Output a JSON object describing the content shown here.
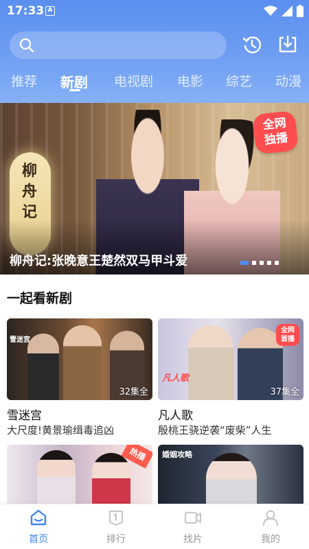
{
  "status_bar": {
    "time": "17:33",
    "notification_glyph": "A",
    "icons": [
      "wifi-icon",
      "signal-icon",
      "battery-icon"
    ]
  },
  "header": {
    "search_placeholder": "",
    "actions": [
      "history-icon",
      "download-icon"
    ],
    "tabs": [
      {
        "label": "推荐",
        "active": false
      },
      {
        "label": "新剧",
        "active": true
      },
      {
        "label": "电视剧",
        "active": false
      },
      {
        "label": "电影",
        "active": false
      },
      {
        "label": "综艺",
        "active": false
      },
      {
        "label": "动漫",
        "active": false
      }
    ]
  },
  "banner": {
    "title": "柳舟记:张晚意王楚然双马甲斗爱",
    "poster_text": "柳舟记",
    "badge": "全网独播",
    "dot_count": 5,
    "active_dot": 0
  },
  "section": {
    "title": "一起看新剧",
    "cards": [
      {
        "title": "雪迷宫",
        "desc": "大尺度!黄景瑜缉毒追凶",
        "count": "32集全",
        "poster_logo": "雪迷宫"
      },
      {
        "title": "凡人歌",
        "desc": "殷桃王骁逆袭“废柴”人生",
        "count": "37集全",
        "poster_logo": "凡人歌",
        "badge": "全网首播"
      },
      {
        "title": "",
        "desc": "",
        "count": "",
        "badge": "热播"
      },
      {
        "title": "",
        "desc": "",
        "count": "",
        "poster_logo": "婚姻攻略"
      }
    ]
  },
  "bottom_nav": [
    {
      "label": "首页",
      "icon": "home-icon",
      "active": true
    },
    {
      "label": "排行",
      "icon": "ranking-icon",
      "active": false
    },
    {
      "label": "找片",
      "icon": "video-camera-icon",
      "active": false
    },
    {
      "label": "我的",
      "icon": "profile-icon",
      "active": false
    }
  ],
  "colors": {
    "header_gradient_top": "#5b8ff0",
    "accent": "#3f86f3",
    "badge_red": "#ff4d4f"
  }
}
